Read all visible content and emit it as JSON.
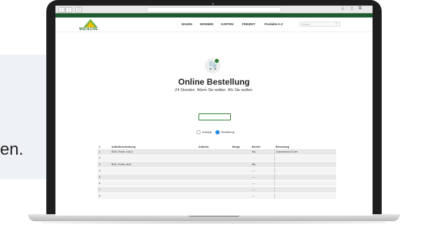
{
  "background": {
    "text": "en."
  },
  "browser": {
    "address": "",
    "nav_back": "‹",
    "nav_forward": "›"
  },
  "top_nav": [
    "",
    "",
    "",
    "",
    "",
    ""
  ],
  "site": {
    "logo_text": "WEISCHE",
    "main_nav": [
      "BAUEN",
      "WOHNEN",
      "GARTEN",
      "FREIZEIT",
      "Produkte A-Z"
    ],
    "search_placeholder": "Suchen"
  },
  "page": {
    "title": "Online Bestellung",
    "subtitle": "24 Stunden. Wann Sie wollen. Wo Sie wollen.",
    "intro": "",
    "cta_label": "",
    "radio_anfrage": "Anfrage",
    "radio_bestellung": "Bestellung"
  },
  "table": {
    "headers": [
      "#",
      "Artikelbeschreibung",
      "Artikelnr.",
      "Menge",
      "Einheit",
      "Bemerkung"
    ],
    "rows": [
      [
        "1",
        "BSH, Fichte, 10x12",
        "",
        "",
        "Stk.",
        "Zuschnitt auf 10,0m"
      ],
      [
        "2",
        "",
        "",
        "",
        "",
        ""
      ],
      [
        "3",
        "BSH, Fichte, 8x12",
        "",
        "",
        "Stk.",
        ""
      ],
      [
        "4",
        "",
        "",
        "",
        "----",
        ""
      ],
      [
        "5",
        "",
        "",
        "",
        "----",
        ""
      ],
      [
        "6",
        "",
        "",
        "",
        "----",
        ""
      ],
      [
        "7",
        "",
        "",
        "",
        "----",
        ""
      ],
      [
        "8",
        "",
        "",
        "",
        "----",
        ""
      ]
    ]
  },
  "colors": {
    "brand_green": "#1d5a2e",
    "accent_orange": "#e8a64c",
    "radio_blue": "#1e88e5"
  }
}
